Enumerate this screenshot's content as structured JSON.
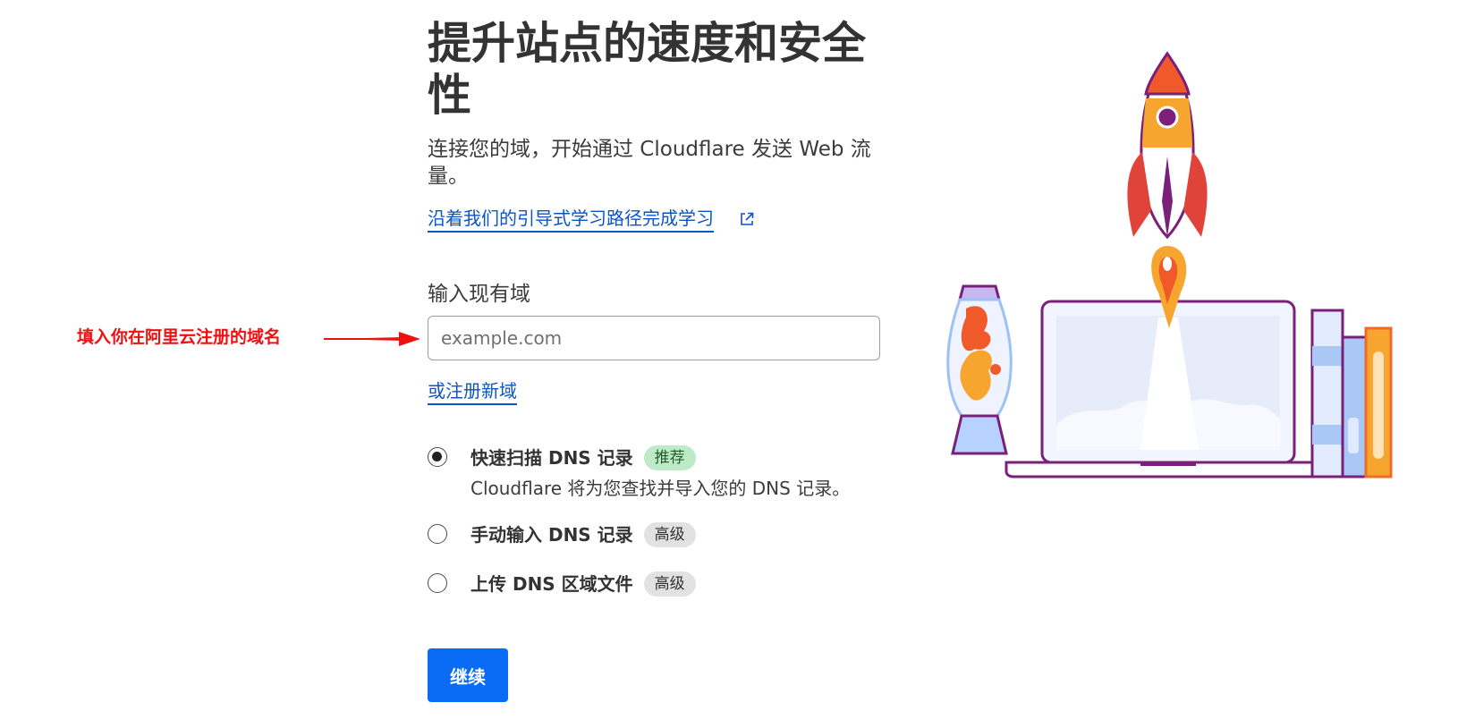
{
  "header": {
    "title": "提升站点的速度和安全性",
    "subtitle": "连接您的域，开始通过 Cloudflare 发送 Web 流量。",
    "guide_link": "沿着我们的引导式学习路径完成学习"
  },
  "domain_form": {
    "label": "输入现有域",
    "placeholder": "example.com",
    "value": "",
    "register_link": "或注册新域"
  },
  "dns_options": [
    {
      "title": "快速扫描 DNS 记录",
      "badge": "推荐",
      "description": "Cloudflare 将为您查找并导入您的 DNS 记录。",
      "selected": true
    },
    {
      "title": "手动输入 DNS 记录",
      "badge": "高级",
      "selected": false
    },
    {
      "title": "上传 DNS 区域文件",
      "badge": "高级",
      "selected": false
    }
  ],
  "actions": {
    "continue_label": "继续"
  },
  "annotation": {
    "text": "填入你在阿里云注册的域名",
    "color": "#ee1111"
  },
  "icons": {
    "guide_link_icon": "external-link-icon",
    "illustration": "rocket-laptop-illustration"
  },
  "colors": {
    "link": "#0b55c4",
    "primary_button": "#0a6cf5",
    "badge_recommended": "#bfeac7",
    "badge_advanced": "#e2e2e2"
  }
}
